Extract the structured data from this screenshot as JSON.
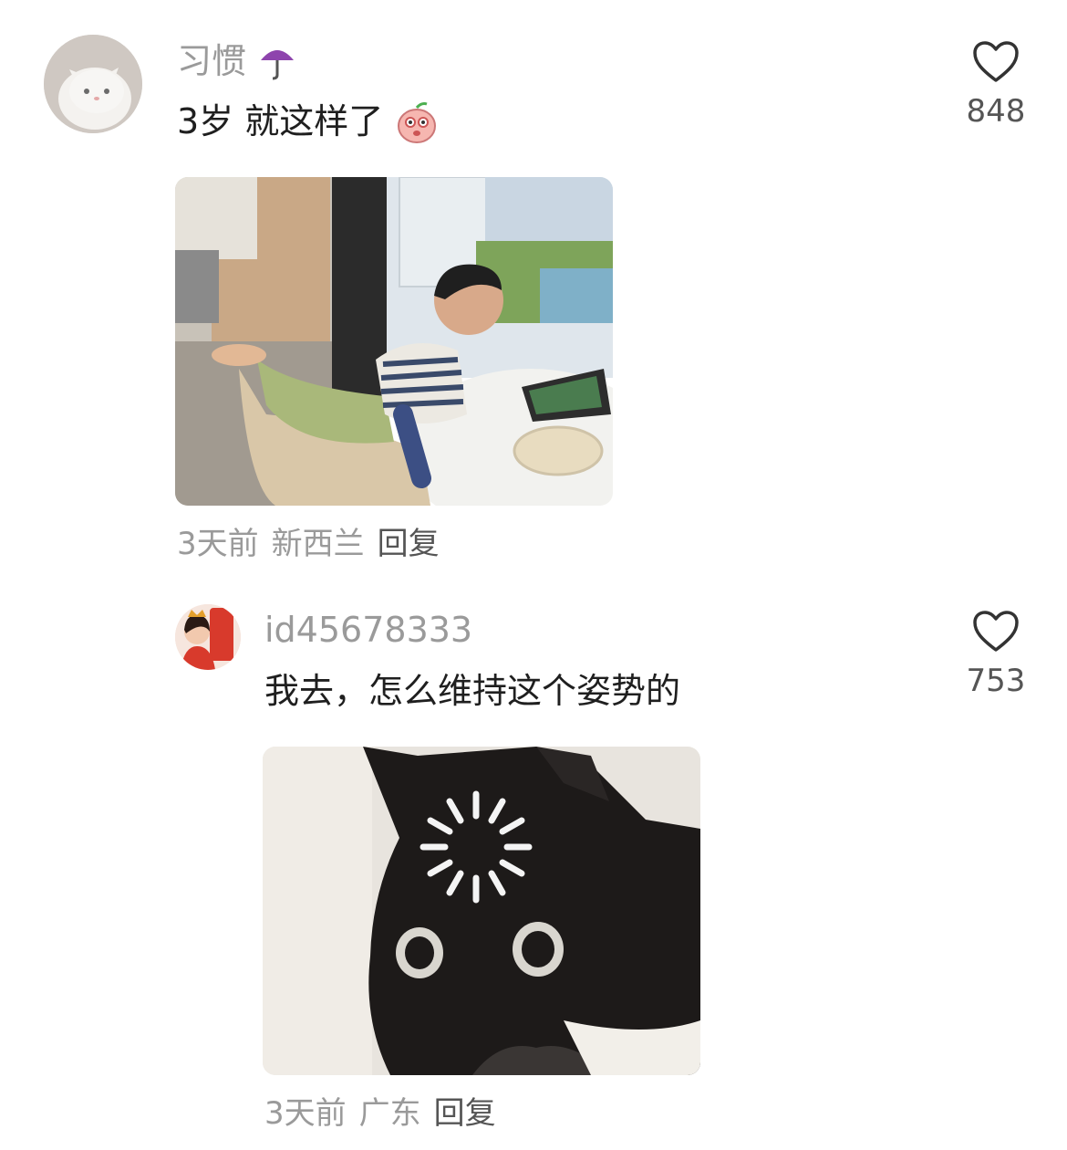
{
  "comments": [
    {
      "username": "习惯",
      "username_emoji": "umbrella",
      "text": "3岁 就这样了",
      "text_emoji": "shy-peach",
      "likes": "848",
      "time": "3天前",
      "location": "新西兰",
      "reply_label": "回复",
      "image": "photo-child-kneeling-at-table"
    },
    {
      "username": "id45678333",
      "text": "我去，怎么维持这个姿势的",
      "likes": "753",
      "time": "3天前",
      "location": "广东",
      "reply_label": "回复",
      "image": "meme-cat-loading-spinner"
    }
  ],
  "icons": {
    "like": "heart-outline-icon"
  },
  "colors": {
    "username": "#9a9a9a",
    "text": "#1f1f1f",
    "reply": "#555555",
    "umbrella": "#8e44ad"
  }
}
